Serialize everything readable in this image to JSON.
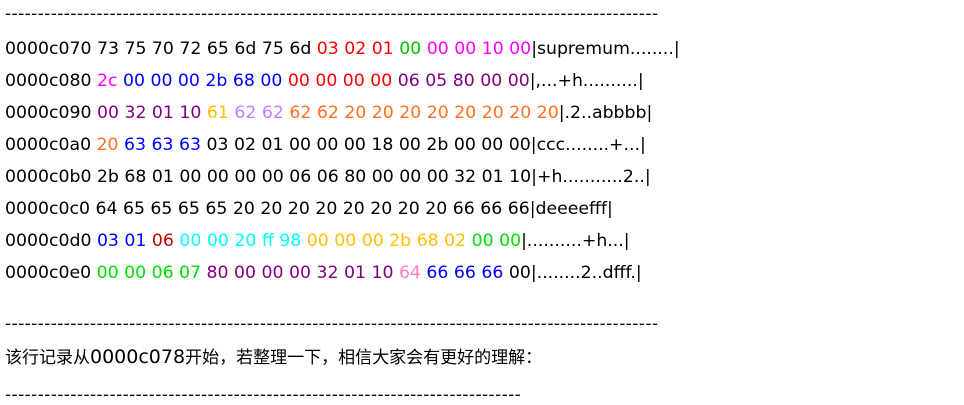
{
  "divider_top": "----------------------------------------------------------------------------------------------------",
  "divider_mid": "----------------------------------------------------------------------------------------------------",
  "divider_bottom": "-------------------------------------------------------------------------------",
  "colors": {
    "black": "#000000",
    "red": "#ff0000",
    "green": "#00c000",
    "magenta": "#ff00ff",
    "blue": "#0000ff",
    "purple": "#800080",
    "crimson": "#c00000",
    "yellow": "#ffc000",
    "violet": "#c080ff",
    "orange": "#ff7020",
    "cyan": "#00ffff",
    "lightgreen": "#00e000",
    "pink": "#ff80c0"
  },
  "dump_lines": [
    {
      "segments": [
        {
          "text": "0000c070 ",
          "color": "black"
        },
        {
          "text": "73 75 70 72 65 6d 75 6d ",
          "color": "black"
        },
        {
          "text": "03 02 01 ",
          "color": "red"
        },
        {
          "text": "00 ",
          "color": "green"
        },
        {
          "text": "00 00 10 00",
          "color": "magenta"
        },
        {
          "text": "|supremum........|",
          "color": "black"
        }
      ]
    },
    {
      "segments": [
        {
          "text": "0000c080 ",
          "color": "black"
        },
        {
          "text": "2c ",
          "color": "magenta"
        },
        {
          "text": "00 00 00 2b 68 00 ",
          "color": "blue"
        },
        {
          "text": "00 00 00 00 ",
          "color": "red"
        },
        {
          "text": "06 05 80 00 00",
          "color": "purple"
        },
        {
          "text": "|,...+h..........|",
          "color": "black"
        }
      ]
    },
    {
      "segments": [
        {
          "text": "0000c090 ",
          "color": "black"
        },
        {
          "text": "00 32 01 10 ",
          "color": "purple"
        },
        {
          "text": "61 ",
          "color": "yellow"
        },
        {
          "text": "62 62 ",
          "color": "violet"
        },
        {
          "text": "62 62 20 20 20 20 20 20 20 20",
          "color": "orange"
        },
        {
          "text": "|.2..abbbb|",
          "color": "black"
        }
      ]
    },
    {
      "segments": [
        {
          "text": "0000c0a0 ",
          "color": "black"
        },
        {
          "text": "20 ",
          "color": "orange"
        },
        {
          "text": "63 63 63 ",
          "color": "blue"
        },
        {
          "text": "03 02 01 00 00 00 18 00 2b 00 00 00",
          "color": "black"
        },
        {
          "text": "|ccc........+...|",
          "color": "black"
        }
      ]
    },
    {
      "segments": [
        {
          "text": "0000c0b0 2b 68 01 00 00 00 00 06 06 80 00 00 00 32 01 10",
          "color": "black"
        },
        {
          "text": "|+h...........2..|",
          "color": "black"
        }
      ]
    },
    {
      "segments": [
        {
          "text": "0000c0c0 64 65 65 65 65 20 20 20 20 20 20 20 20 66 66 66",
          "color": "black"
        },
        {
          "text": "|deeeefff|",
          "color": "black"
        }
      ]
    },
    {
      "segments": [
        {
          "text": "0000c0d0 ",
          "color": "black"
        },
        {
          "text": "03 01 ",
          "color": "blue"
        },
        {
          "text": "06 ",
          "color": "crimson"
        },
        {
          "text": "00 00 20 ff 98 ",
          "color": "cyan"
        },
        {
          "text": "00 00 00 2b 68 02 ",
          "color": "yellow"
        },
        {
          "text": "00 00",
          "color": "lightgreen"
        },
        {
          "text": "|..........+h...|",
          "color": "black"
        }
      ]
    },
    {
      "segments": [
        {
          "text": "0000c0e0 ",
          "color": "black"
        },
        {
          "text": "00 00 06 07 ",
          "color": "lightgreen"
        },
        {
          "text": "80 00 00 00 32 01 10 ",
          "color": "purple"
        },
        {
          "text": "64 ",
          "color": "pink"
        },
        {
          "text": "66 66 66 ",
          "color": "blue"
        },
        {
          "text": "00",
          "color": "black"
        },
        {
          "text": "|........2..dfff.|",
          "color": "black"
        }
      ]
    }
  ],
  "note": {
    "prefix": "该行记录从",
    "address": "0000c078",
    "suffix": "开始，若整理一下，相信大家会有更好的理解："
  }
}
